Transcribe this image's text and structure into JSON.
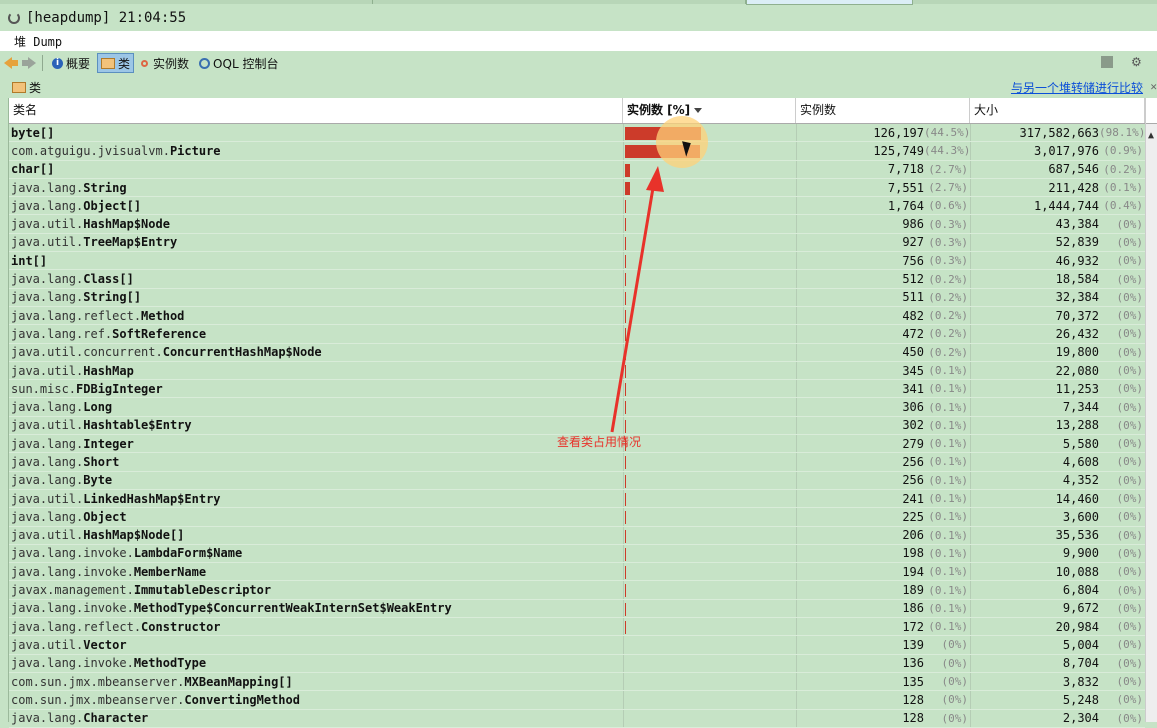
{
  "window": {
    "title": "[heapdump] 21:04:55"
  },
  "subheader": {
    "label": "堆 Dump"
  },
  "toolbar": {
    "summary": "概要",
    "classes": "类",
    "instances": "实例数",
    "oql": "OQL 控制台"
  },
  "panel": {
    "title": "类",
    "compare_link": "与另一个堆转储进行比较"
  },
  "table": {
    "headers": {
      "name": "类名",
      "bar": "实例数 [%]",
      "count": "实例数",
      "size": "大小"
    },
    "rows": [
      {
        "pkg": "",
        "cls": "byte[]",
        "count": "126,197",
        "count_pct": "(44.5%)",
        "size": "317,582,663",
        "size_pct": "(98.1%)",
        "frac": 0.445
      },
      {
        "pkg": "com.atguigu.jvisualvm.",
        "cls": "Picture",
        "count": "125,749",
        "count_pct": "(44.3%)",
        "size": "3,017,976",
        "size_pct": "(0.9%)",
        "frac": 0.443
      },
      {
        "pkg": "",
        "cls": "char[]",
        "count": "7,718",
        "count_pct": "(2.7%)",
        "size": "687,546",
        "size_pct": "(0.2%)",
        "frac": 0.027
      },
      {
        "pkg": "java.lang.",
        "cls": "String",
        "count": "7,551",
        "count_pct": "(2.7%)",
        "size": "211,428",
        "size_pct": "(0.1%)",
        "frac": 0.027
      },
      {
        "pkg": "java.lang.",
        "cls": "Object[]",
        "count": "1,764",
        "count_pct": "(0.6%)",
        "size": "1,444,744",
        "size_pct": "(0.4%)",
        "frac": 0.006
      },
      {
        "pkg": "java.util.",
        "cls": "HashMap$Node",
        "count": "986",
        "count_pct": "(0.3%)",
        "size": "43,384",
        "size_pct": "(0%)",
        "frac": 0.003
      },
      {
        "pkg": "java.util.",
        "cls": "TreeMap$Entry",
        "count": "927",
        "count_pct": "(0.3%)",
        "size": "52,839",
        "size_pct": "(0%)",
        "frac": 0.003
      },
      {
        "pkg": "",
        "cls": "int[]",
        "count": "756",
        "count_pct": "(0.3%)",
        "size": "46,932",
        "size_pct": "(0%)",
        "frac": 0.003
      },
      {
        "pkg": "java.lang.",
        "cls": "Class[]",
        "count": "512",
        "count_pct": "(0.2%)",
        "size": "18,584",
        "size_pct": "(0%)",
        "frac": 0.002
      },
      {
        "pkg": "java.lang.",
        "cls": "String[]",
        "count": "511",
        "count_pct": "(0.2%)",
        "size": "32,384",
        "size_pct": "(0%)",
        "frac": 0.002
      },
      {
        "pkg": "java.lang.reflect.",
        "cls": "Method",
        "count": "482",
        "count_pct": "(0.2%)",
        "size": "70,372",
        "size_pct": "(0%)",
        "frac": 0.002
      },
      {
        "pkg": "java.lang.ref.",
        "cls": "SoftReference",
        "count": "472",
        "count_pct": "(0.2%)",
        "size": "26,432",
        "size_pct": "(0%)",
        "frac": 0.002
      },
      {
        "pkg": "java.util.concurrent.",
        "cls": "ConcurrentHashMap$Node",
        "count": "450",
        "count_pct": "(0.2%)",
        "size": "19,800",
        "size_pct": "(0%)",
        "frac": 0.002
      },
      {
        "pkg": "java.util.",
        "cls": "HashMap",
        "count": "345",
        "count_pct": "(0.1%)",
        "size": "22,080",
        "size_pct": "(0%)",
        "frac": 0.001
      },
      {
        "pkg": "sun.misc.",
        "cls": "FDBigInteger",
        "count": "341",
        "count_pct": "(0.1%)",
        "size": "11,253",
        "size_pct": "(0%)",
        "frac": 0.001
      },
      {
        "pkg": "java.lang.",
        "cls": "Long",
        "count": "306",
        "count_pct": "(0.1%)",
        "size": "7,344",
        "size_pct": "(0%)",
        "frac": 0.001
      },
      {
        "pkg": "java.util.",
        "cls": "Hashtable$Entry",
        "count": "302",
        "count_pct": "(0.1%)",
        "size": "13,288",
        "size_pct": "(0%)",
        "frac": 0.001
      },
      {
        "pkg": "java.lang.",
        "cls": "Integer",
        "count": "279",
        "count_pct": "(0.1%)",
        "size": "5,580",
        "size_pct": "(0%)",
        "frac": 0.001
      },
      {
        "pkg": "java.lang.",
        "cls": "Short",
        "count": "256",
        "count_pct": "(0.1%)",
        "size": "4,608",
        "size_pct": "(0%)",
        "frac": 0.001
      },
      {
        "pkg": "java.lang.",
        "cls": "Byte",
        "count": "256",
        "count_pct": "(0.1%)",
        "size": "4,352",
        "size_pct": "(0%)",
        "frac": 0.001
      },
      {
        "pkg": "java.util.",
        "cls": "LinkedHashMap$Entry",
        "count": "241",
        "count_pct": "(0.1%)",
        "size": "14,460",
        "size_pct": "(0%)",
        "frac": 0.001
      },
      {
        "pkg": "java.lang.",
        "cls": "Object",
        "count": "225",
        "count_pct": "(0.1%)",
        "size": "3,600",
        "size_pct": "(0%)",
        "frac": 0.001
      },
      {
        "pkg": "java.util.",
        "cls": "HashMap$Node[]",
        "count": "206",
        "count_pct": "(0.1%)",
        "size": "35,536",
        "size_pct": "(0%)",
        "frac": 0.001
      },
      {
        "pkg": "java.lang.invoke.",
        "cls": "LambdaForm$Name",
        "count": "198",
        "count_pct": "(0.1%)",
        "size": "9,900",
        "size_pct": "(0%)",
        "frac": 0.001
      },
      {
        "pkg": "java.lang.invoke.",
        "cls": "MemberName",
        "count": "194",
        "count_pct": "(0.1%)",
        "size": "10,088",
        "size_pct": "(0%)",
        "frac": 0.001
      },
      {
        "pkg": "javax.management.",
        "cls": "ImmutableDescriptor",
        "count": "189",
        "count_pct": "(0.1%)",
        "size": "6,804",
        "size_pct": "(0%)",
        "frac": 0.001
      },
      {
        "pkg": "java.lang.invoke.",
        "cls": "MethodType$ConcurrentWeakInternSet$WeakEntry",
        "count": "186",
        "count_pct": "(0.1%)",
        "size": "9,672",
        "size_pct": "(0%)",
        "frac": 0.001
      },
      {
        "pkg": "java.lang.reflect.",
        "cls": "Constructor",
        "count": "172",
        "count_pct": "(0.1%)",
        "size": "20,984",
        "size_pct": "(0%)",
        "frac": 0.001
      },
      {
        "pkg": "java.util.",
        "cls": "Vector",
        "count": "139",
        "count_pct": "(0%)",
        "size": "5,004",
        "size_pct": "(0%)",
        "frac": 0.0
      },
      {
        "pkg": "java.lang.invoke.",
        "cls": "MethodType",
        "count": "136",
        "count_pct": "(0%)",
        "size": "8,704",
        "size_pct": "(0%)",
        "frac": 0.0
      },
      {
        "pkg": "com.sun.jmx.mbeanserver.",
        "cls": "MXBeanMapping[]",
        "count": "135",
        "count_pct": "(0%)",
        "size": "3,832",
        "size_pct": "(0%)",
        "frac": 0.0
      },
      {
        "pkg": "com.sun.jmx.mbeanserver.",
        "cls": "ConvertingMethod",
        "count": "128",
        "count_pct": "(0%)",
        "size": "5,248",
        "size_pct": "(0%)",
        "frac": 0.0
      },
      {
        "pkg": "java.lang.",
        "cls": "Character",
        "count": "128",
        "count_pct": "(0%)",
        "size": "2,304",
        "size_pct": "(0%)",
        "frac": 0.0
      }
    ]
  },
  "annotation": {
    "text": "查看类占用情况"
  },
  "colors": {
    "bar": "#cc3b2a",
    "annotation": "#e8322a",
    "link": "#0b4fd8",
    "row_bg": "#c6e3c6"
  }
}
